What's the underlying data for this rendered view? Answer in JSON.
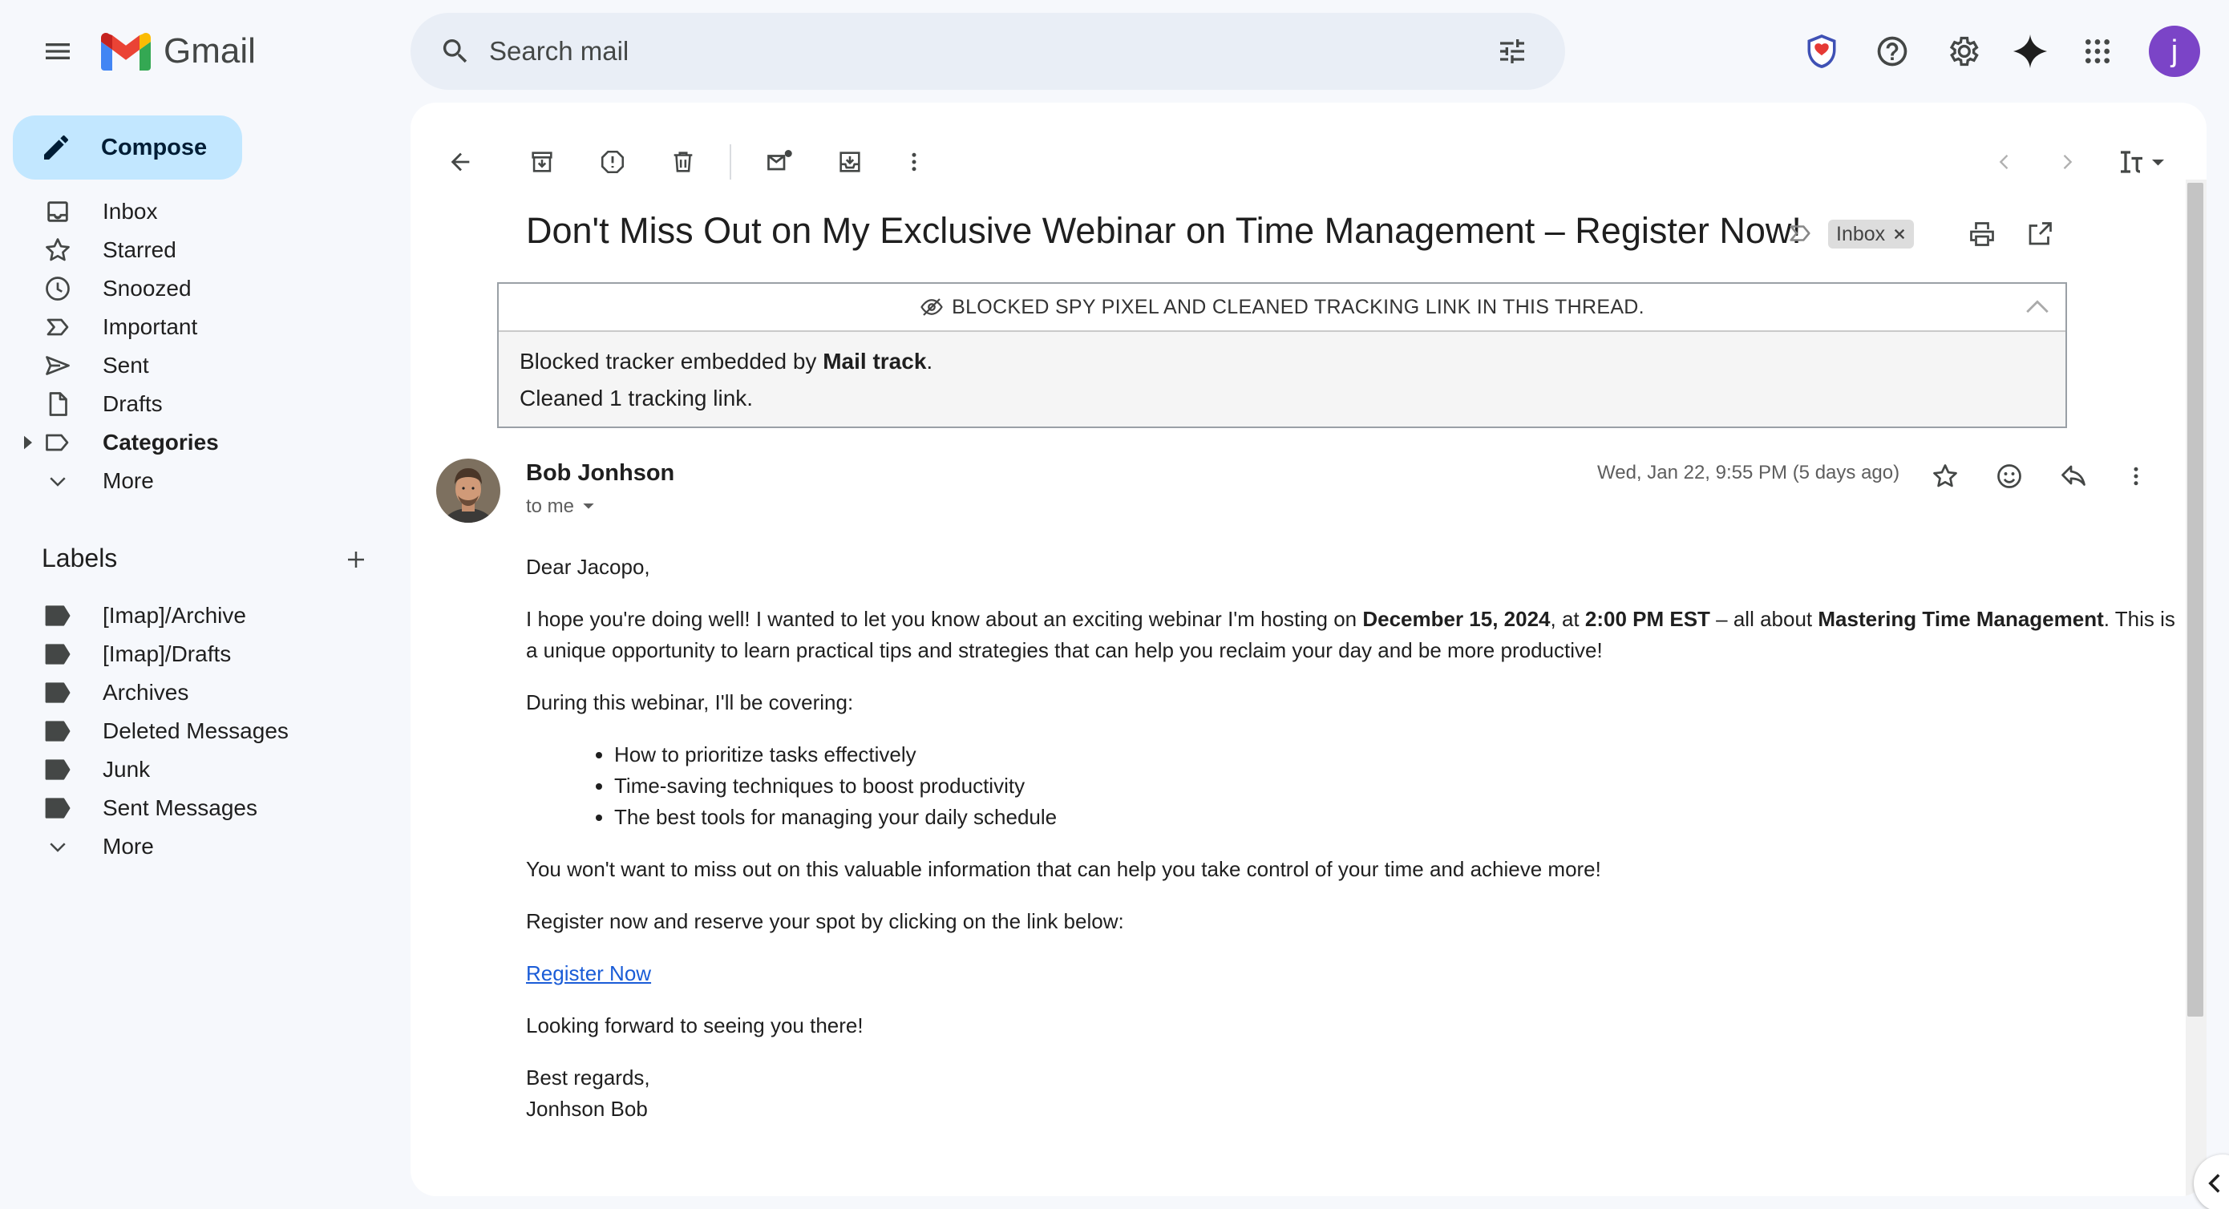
{
  "app": {
    "name": "Gmail",
    "brand_colors": {
      "accent": "#0b57d0",
      "compose_bg": "#c2e7ff",
      "avatar_bg": "#7b44c7"
    }
  },
  "search": {
    "placeholder": "Search mail"
  },
  "header": {
    "avatar_letter": "j"
  },
  "compose": {
    "label": "Compose"
  },
  "nav": [
    {
      "label": "Inbox",
      "icon": "inbox-icon"
    },
    {
      "label": "Starred",
      "icon": "star-icon"
    },
    {
      "label": "Snoozed",
      "icon": "clock-icon"
    },
    {
      "label": "Important",
      "icon": "important-icon"
    },
    {
      "label": "Sent",
      "icon": "send-icon"
    },
    {
      "label": "Drafts",
      "icon": "draft-icon"
    },
    {
      "label": "Categories",
      "icon": "label-icon"
    },
    {
      "label": "More",
      "icon": "chevron-down-icon"
    }
  ],
  "labels_section": {
    "title": "Labels",
    "items": [
      "[Imap]/Archive",
      "[Imap]/Drafts",
      "Archives",
      "Deleted Messages",
      "Junk",
      "Sent Messages"
    ],
    "more": "More"
  },
  "email": {
    "subject": "Don't Miss Out on My Exclusive Webinar on Time Management – Register Now!",
    "chip": "Inbox",
    "tracker": {
      "headline": "BLOCKED SPY PIXEL AND CLEANED TRACKING LINK IN THIS THREAD.",
      "line1_prefix": "Blocked tracker embedded by ",
      "line1_bold": "Mail track",
      "line1_suffix": ".",
      "line2": "Cleaned 1 tracking link."
    },
    "sender": {
      "name": "Bob Jonhson",
      "to": "to me"
    },
    "date": "Wed, Jan 22, 9:55 PM (5 days ago)",
    "body": {
      "greeting": "Dear Jacopo,",
      "p1_a": "I hope you're doing well! I wanted to let you know about an exciting webinar I'm hosting on ",
      "p1_date": "December 15, 2024",
      "p1_b": ", at ",
      "p1_time": "2:00 PM EST",
      "p1_c": " – all about ",
      "p1_topic": "Mastering Time Management",
      "p1_d": ". This is a unique opportunity to learn practical tips and strategies that can help you reclaim your day and be more productive!",
      "p2": "During this webinar, I'll be covering:",
      "bullets": [
        "How to prioritize tasks effectively",
        "Time-saving techniques to boost productivity",
        "The best tools for managing your daily schedule"
      ],
      "p3": "You won't want to miss out on this valuable information that can help you take control of your time and achieve more!",
      "p4": "Register now and reserve your spot by clicking on the link below:",
      "link": "Register Now",
      "p5": "Looking forward to seeing you there!",
      "signoff": "Best regards,",
      "signature": "Jonhson Bob"
    }
  }
}
